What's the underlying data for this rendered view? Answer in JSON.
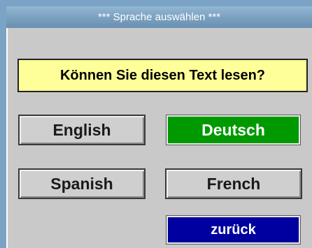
{
  "dialog": {
    "title": "*** Sprache auswählen ***",
    "question": "Können Sie diesen Text lesen?"
  },
  "languages": {
    "english": "English",
    "deutsch": "Deutsch",
    "spanish": "Spanish",
    "french": "French"
  },
  "selected_language": "Deutsch",
  "back_label": "zurück",
  "colors": {
    "title_bar": "#7aa0c0",
    "question_background": "#ffff9a",
    "selected_button": "#009a00",
    "back_button": "#0000a0",
    "button_background": "#cfcfcf",
    "panel_background": "#c9c9c9"
  }
}
